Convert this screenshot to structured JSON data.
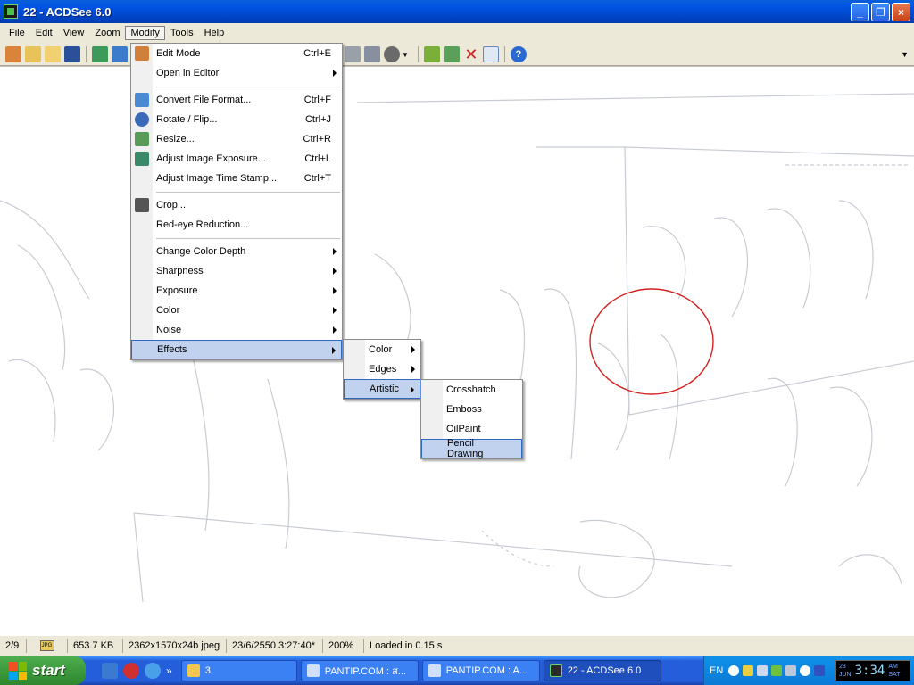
{
  "window": {
    "title": "22 - ACDSee 6.0",
    "minimize": "_",
    "restore": "❐",
    "close": "×"
  },
  "menubar": [
    "File",
    "Edit",
    "View",
    "Zoom",
    "Modify",
    "Tools",
    "Help"
  ],
  "modify_menu": [
    {
      "label": "Edit Mode",
      "shortcut": "Ctrl+E"
    },
    {
      "label": "Open in Editor",
      "submenu": true
    },
    {
      "sep": true
    },
    {
      "label": "Convert File Format...",
      "shortcut": "Ctrl+F"
    },
    {
      "label": "Rotate / Flip...",
      "shortcut": "Ctrl+J"
    },
    {
      "label": "Resize...",
      "shortcut": "Ctrl+R"
    },
    {
      "label": "Adjust Image Exposure...",
      "shortcut": "Ctrl+L"
    },
    {
      "label": "Adjust Image Time Stamp...",
      "shortcut": "Ctrl+T"
    },
    {
      "sep": true
    },
    {
      "label": "Crop..."
    },
    {
      "label": "Red-eye Reduction..."
    },
    {
      "sep": true
    },
    {
      "label": "Change Color Depth",
      "submenu": true
    },
    {
      "label": "Sharpness",
      "submenu": true
    },
    {
      "label": "Exposure",
      "submenu": true
    },
    {
      "label": "Color",
      "submenu": true
    },
    {
      "label": "Noise",
      "submenu": true
    },
    {
      "label": "Effects",
      "submenu": true,
      "highlighted": true
    }
  ],
  "effects_menu": [
    {
      "label": "Color",
      "submenu": true
    },
    {
      "label": "Edges",
      "submenu": true
    },
    {
      "label": "Artistic",
      "submenu": true,
      "highlighted": true
    }
  ],
  "artistic_menu": [
    {
      "label": "Crosshatch"
    },
    {
      "label": "Emboss"
    },
    {
      "label": "OilPaint"
    },
    {
      "label": "Pencil Drawing",
      "highlighted": true
    }
  ],
  "status": {
    "position": "2/9",
    "file_type_badge": "JPG",
    "size": "653.7 KB",
    "dimensions": "2362x1570x24b jpeg",
    "date": "23/6/2550 3:27:40*",
    "zoom": "200%",
    "load_time": "Loaded in 0.15 s"
  },
  "taskbar": {
    "start": "start",
    "quicklaunch_more": "»",
    "tasks": [
      {
        "label": "3",
        "icon": "folder-icon"
      },
      {
        "label": "PANTIP.COM : ส...",
        "icon": "ie-icon"
      },
      {
        "label": "PANTIP.COM : A...",
        "icon": "ie-icon"
      },
      {
        "label": "22 - ACDSee 6.0",
        "icon": "acdsee-icon",
        "active": true
      }
    ],
    "tray": {
      "lang": "EN",
      "clock_date": "23",
      "clock_month": "JUN",
      "clock_day": "SAT",
      "clock_ampm": "AM",
      "clock_time": "3:34"
    }
  }
}
